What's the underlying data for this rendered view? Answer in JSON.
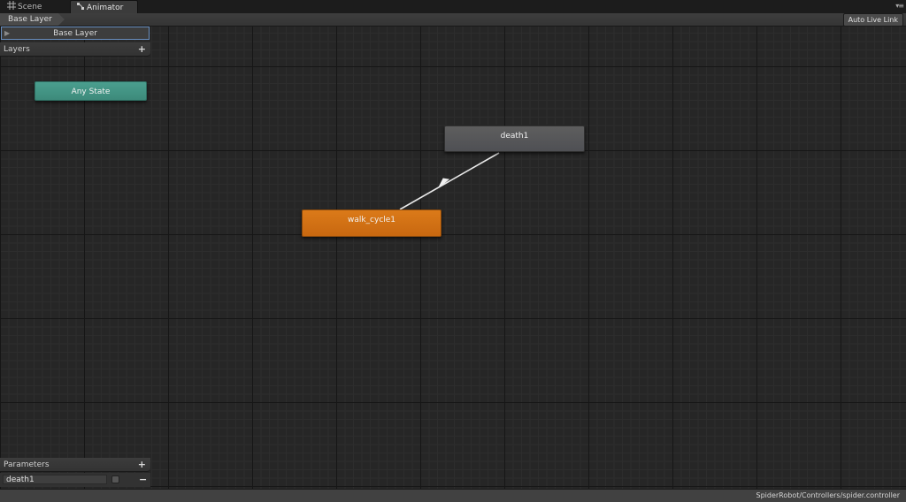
{
  "tabs": [
    {
      "label": "Scene",
      "icon": "grid-icon"
    },
    {
      "label": "Animator",
      "icon": "animator-icon"
    }
  ],
  "toolbar": {
    "breadcrumb": "Base Layer",
    "auto_live_link": "Auto Live Link"
  },
  "layers_panel": {
    "active_layer": "Base Layer",
    "header": "Layers",
    "add": "+"
  },
  "parameters_panel": {
    "header": "Parameters",
    "add": "+",
    "items": [
      {
        "name": "death1",
        "type": "bool",
        "value": false,
        "remove": "−"
      }
    ]
  },
  "states": {
    "any_state": "Any State",
    "death": "death1",
    "walk": "walk_cycle1"
  },
  "transitions": [
    {
      "from": "walk_cycle1",
      "to": "death1"
    }
  ],
  "status_bar": {
    "path": "SpiderRobot/Controllers/spider.controller"
  },
  "colors": {
    "any_state": "#3d8a7b",
    "default_state": "#db7a19",
    "state": "#55565a",
    "transition": "#e8e8e8"
  }
}
